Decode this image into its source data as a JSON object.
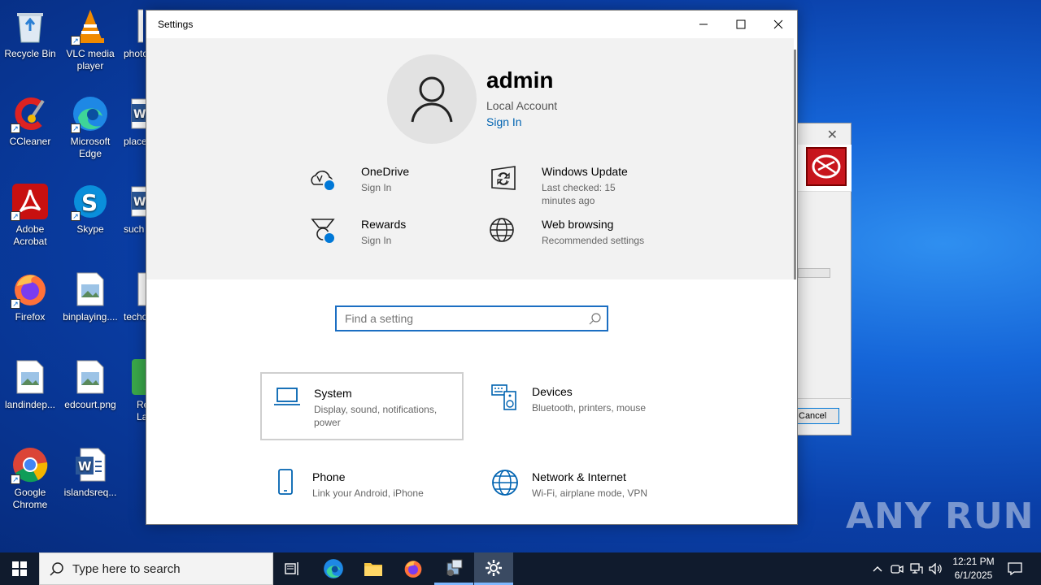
{
  "desktop": {
    "icons": [
      {
        "label": "Recycle Bin"
      },
      {
        "label": "VLC media player"
      },
      {
        "label": "photo"
      },
      {
        "label": "CCleaner"
      },
      {
        "label": "Microsoft Edge"
      },
      {
        "label": "place"
      },
      {
        "label": "Adobe Acrobat"
      },
      {
        "label": "Skype"
      },
      {
        "label": "such"
      },
      {
        "label": "Firefox"
      },
      {
        "label": "binplaying...."
      },
      {
        "label": "techo"
      },
      {
        "label": "landindep..."
      },
      {
        "label": "edcourt.png"
      },
      {
        "label": "Re Lau"
      },
      {
        "label": "Google Chrome"
      },
      {
        "label": "islandsreq..."
      }
    ]
  },
  "background_dialog": {
    "cancel_label": "Cancel",
    "accent": "#c8161d"
  },
  "settings": {
    "window_title": "Settings",
    "user": {
      "name": "admin",
      "account_type": "Local Account",
      "sign_in_link": "Sign In"
    },
    "services": [
      {
        "title": "OneDrive",
        "subtitle": "Sign In",
        "icon": "cloud-icon"
      },
      {
        "title": "Windows Update",
        "subtitle": "Last checked: 15 minutes ago",
        "icon": "update-icon"
      },
      {
        "title": "Rewards",
        "subtitle": "Sign In",
        "icon": "medal-icon"
      },
      {
        "title": "Web browsing",
        "subtitle": "Recommended settings",
        "icon": "globe-icon"
      }
    ],
    "search_placeholder": "Find a setting",
    "categories": [
      {
        "title": "System",
        "subtitle": "Display, sound, notifications, power",
        "icon": "laptop-icon"
      },
      {
        "title": "Devices",
        "subtitle": "Bluetooth, printers, mouse",
        "icon": "keyboard-speaker-icon"
      },
      {
        "title": "Phone",
        "subtitle": "Link your Android, iPhone",
        "icon": "phone-icon"
      },
      {
        "title": "Network & Internet",
        "subtitle": "Wi-Fi, airplane mode, VPN",
        "icon": "globe-icon"
      }
    ],
    "accent": "#0078d7"
  },
  "watermark": {
    "text": "ANY RUN"
  },
  "taskbar": {
    "search_placeholder": "Type here to search",
    "time": "12:21 PM",
    "date": "6/1/2025"
  }
}
